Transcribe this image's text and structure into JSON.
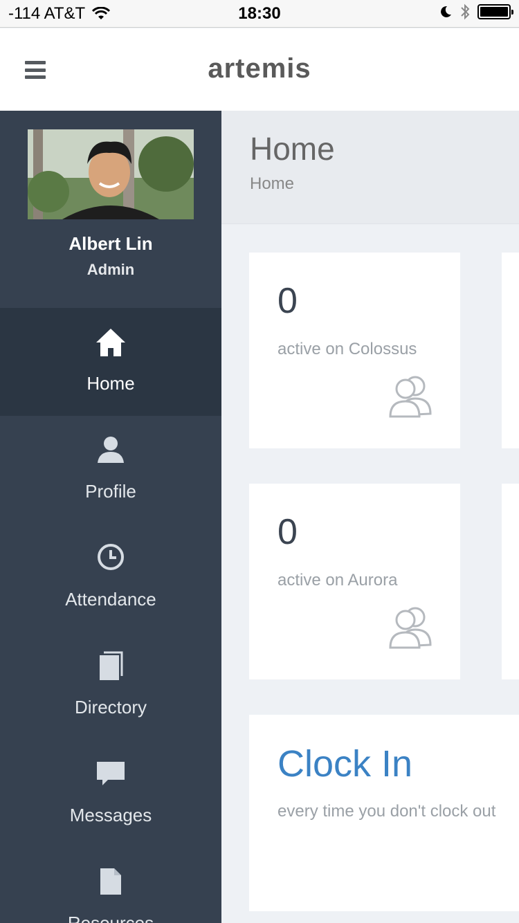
{
  "status_bar": {
    "carrier": "-114 AT&T",
    "time": "18:30",
    "icons": [
      "wifi-icon",
      "moon-icon",
      "bluetooth-icon",
      "battery-icon"
    ]
  },
  "topnav": {
    "brand": "artemis",
    "menu_icon": "hamburger-icon"
  },
  "sidebar": {
    "user": {
      "name": "Albert Lin",
      "role": "Admin"
    },
    "items": [
      {
        "label": "Home",
        "icon": "home-icon",
        "active": true
      },
      {
        "label": "Profile",
        "icon": "user-icon",
        "active": false
      },
      {
        "label": "Attendance",
        "icon": "clock-icon",
        "active": false
      },
      {
        "label": "Directory",
        "icon": "book-icon",
        "active": false
      },
      {
        "label": "Messages",
        "icon": "chat-icon",
        "active": false
      },
      {
        "label": "Resources",
        "icon": "file-icon",
        "active": false
      }
    ]
  },
  "page": {
    "title": "Home",
    "breadcrumb": "Home"
  },
  "stats": [
    {
      "count": "0",
      "label": "active on Colossus",
      "icon": "users-icon"
    },
    {
      "count": "0",
      "label": "active on Aurora",
      "icon": "users-icon"
    }
  ],
  "clock_card": {
    "title": "Clock In",
    "description": "every time you don't clock out"
  },
  "colors": {
    "sidebar_bg": "#364150",
    "sidebar_active": "#2b3643",
    "accent": "#3b82c4"
  }
}
